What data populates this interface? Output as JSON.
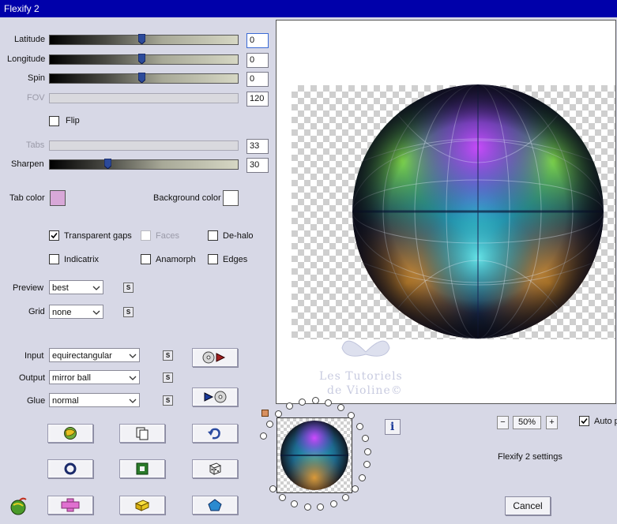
{
  "window": {
    "title": "Flexify 2"
  },
  "sliders": {
    "latitude": {
      "label": "Latitude",
      "value": "0",
      "level": 0.49
    },
    "longitude": {
      "label": "Longitude",
      "value": "0",
      "level": 0.49
    },
    "spin": {
      "label": "Spin",
      "value": "0",
      "level": 0.49
    },
    "fov": {
      "label": "FOV",
      "value": "120"
    },
    "tabs": {
      "label": "Tabs",
      "value": "33"
    },
    "sharpen": {
      "label": "Sharpen",
      "value": "30",
      "level": 0.3
    }
  },
  "flip": {
    "label": "Flip",
    "checked": false
  },
  "tab_color": {
    "label": "Tab color",
    "color": "#d8a8d8"
  },
  "background_color": {
    "label": "Background color",
    "color": "#ffffff"
  },
  "options": {
    "transparent_gaps": {
      "label": "Transparent gaps",
      "checked": true
    },
    "faces": {
      "label": "Faces",
      "checked": false
    },
    "de_halo": {
      "label": "De-halo",
      "checked": false
    },
    "indicatrix": {
      "label": "Indicatrix",
      "checked": false
    },
    "anamorph": {
      "label": "Anamorph",
      "checked": false
    },
    "edges": {
      "label": "Edges",
      "checked": false
    }
  },
  "preview_select": {
    "label": "Preview",
    "value": "best"
  },
  "grid_select": {
    "label": "Grid",
    "value": "none"
  },
  "input_select": {
    "label": "Input",
    "value": "equirectangular"
  },
  "output_select": {
    "label": "Output",
    "value": "mirror ball"
  },
  "glue_select": {
    "label": "Glue",
    "value": "normal"
  },
  "s_label": "S",
  "watermark": {
    "line1": "Les Tutoriels",
    "line2": "de Violine©"
  },
  "zoom": {
    "minus": "−",
    "value": "50%",
    "plus": "+"
  },
  "auto_preview": {
    "label": "Auto p",
    "checked": true
  },
  "settings_label": "Flexify 2 settings",
  "info_label": "i",
  "cancel_label": "Cancel",
  "colors": {
    "title_bar": "#0000aa",
    "panel": "#d7d8e6"
  }
}
